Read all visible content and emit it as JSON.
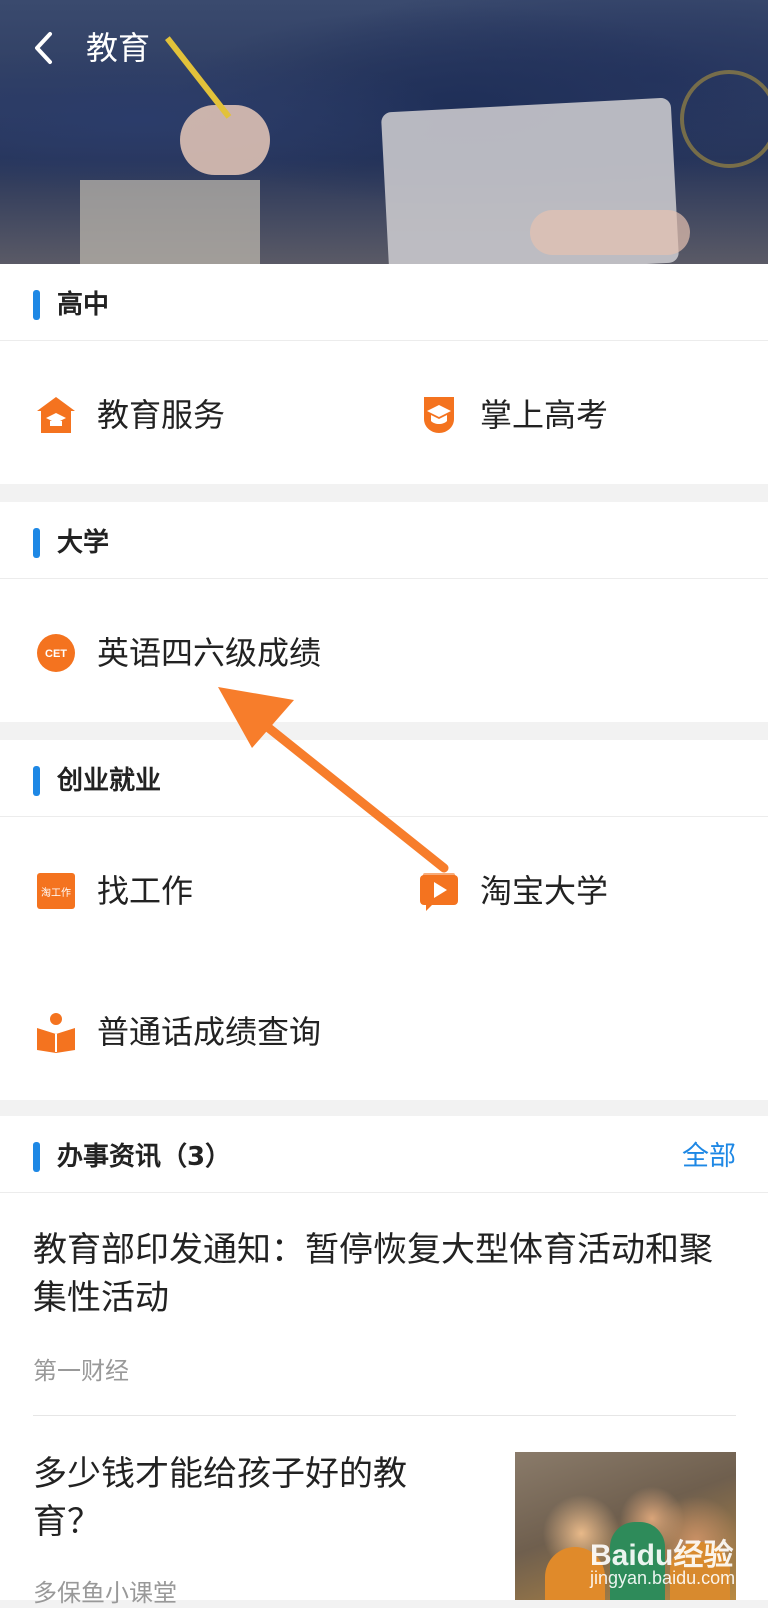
{
  "header": {
    "title": "教育"
  },
  "sections": {
    "high_school": {
      "title": "高中",
      "items": [
        "教育服务",
        "掌上高考"
      ]
    },
    "university": {
      "title": "大学",
      "items": [
        "英语四六级成绩"
      ]
    },
    "career": {
      "title": "创业就业",
      "items": [
        "找工作",
        "淘宝大学",
        "普通话成绩查询"
      ]
    },
    "news": {
      "title": "办事资讯（3）",
      "more_label": "全部",
      "articles": [
        {
          "title_line1": "教育部印发通知：暂停恢复大型体育活动和聚",
          "title_line2": "集性活动",
          "source": "第一财经"
        },
        {
          "title_line1": "多少钱才能给孩子好的教",
          "title_line2": "育？",
          "source": "多保鱼小课堂"
        }
      ]
    }
  },
  "icons": {
    "back": "chevron-left-icon",
    "education_service": "graduation-house-icon",
    "gaokao": "graduation-cap-icon",
    "cet": "cet-badge-icon",
    "job": "job-tag-icon",
    "taobao_university": "video-play-icon",
    "mandarin": "open-book-icon"
  },
  "icon_labels": {
    "cet": "CET",
    "job": "淘工作"
  },
  "watermark": {
    "brand": "Baidu经验",
    "url": "jingyan.baidu.com"
  },
  "colors": {
    "accent": "#1e88e5",
    "icon_orange": "#f4731f",
    "arrow": "#f77d2b"
  }
}
